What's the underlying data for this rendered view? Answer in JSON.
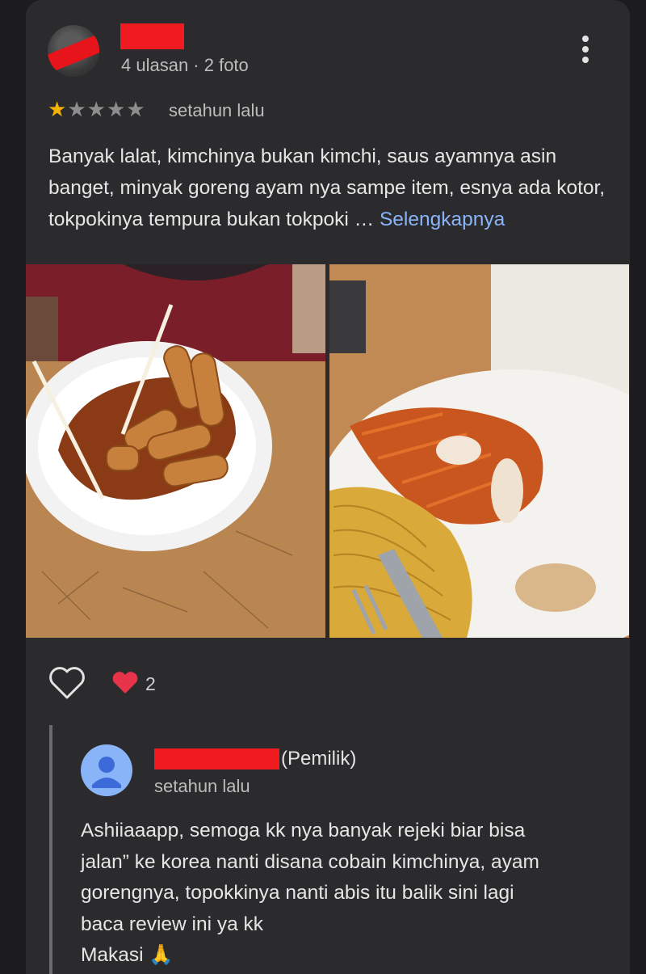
{
  "review": {
    "meta": "4 ulasan · 2 foto",
    "rating": 1,
    "rating_max": 5,
    "time": "setahun lalu",
    "text": "Banyak lalat, kimchinya bukan kimchi, saus ayamnya asin banget, minyak goreng ayam nya sampe item, esnya ada kotor, tokpokinya tempura bukan tokpoki",
    "ellipsis": " … ",
    "more_label": "Selengkapnya",
    "photos": [
      "tteokbokki-photo",
      "kimchi-noodles-photo"
    ]
  },
  "reactions": {
    "count": "2"
  },
  "owner_reply": {
    "label": "(Pemilik)",
    "time": "setahun lalu",
    "lines": [
      "Ashiiaaapp, semoga kk nya banyak rejeki biar bisa",
      "jalan” ke korea nanti disana cobain kimchinya, ayam",
      "gorengnya, topokkinya nanti abis itu balik sini lagi",
      "baca review ini ya kk",
      "Makasi 🙏"
    ]
  },
  "colors": {
    "star": "#f6b400",
    "link": "#8ab4f8",
    "redaction": "#ef1b20",
    "heart": "#e8344a"
  }
}
